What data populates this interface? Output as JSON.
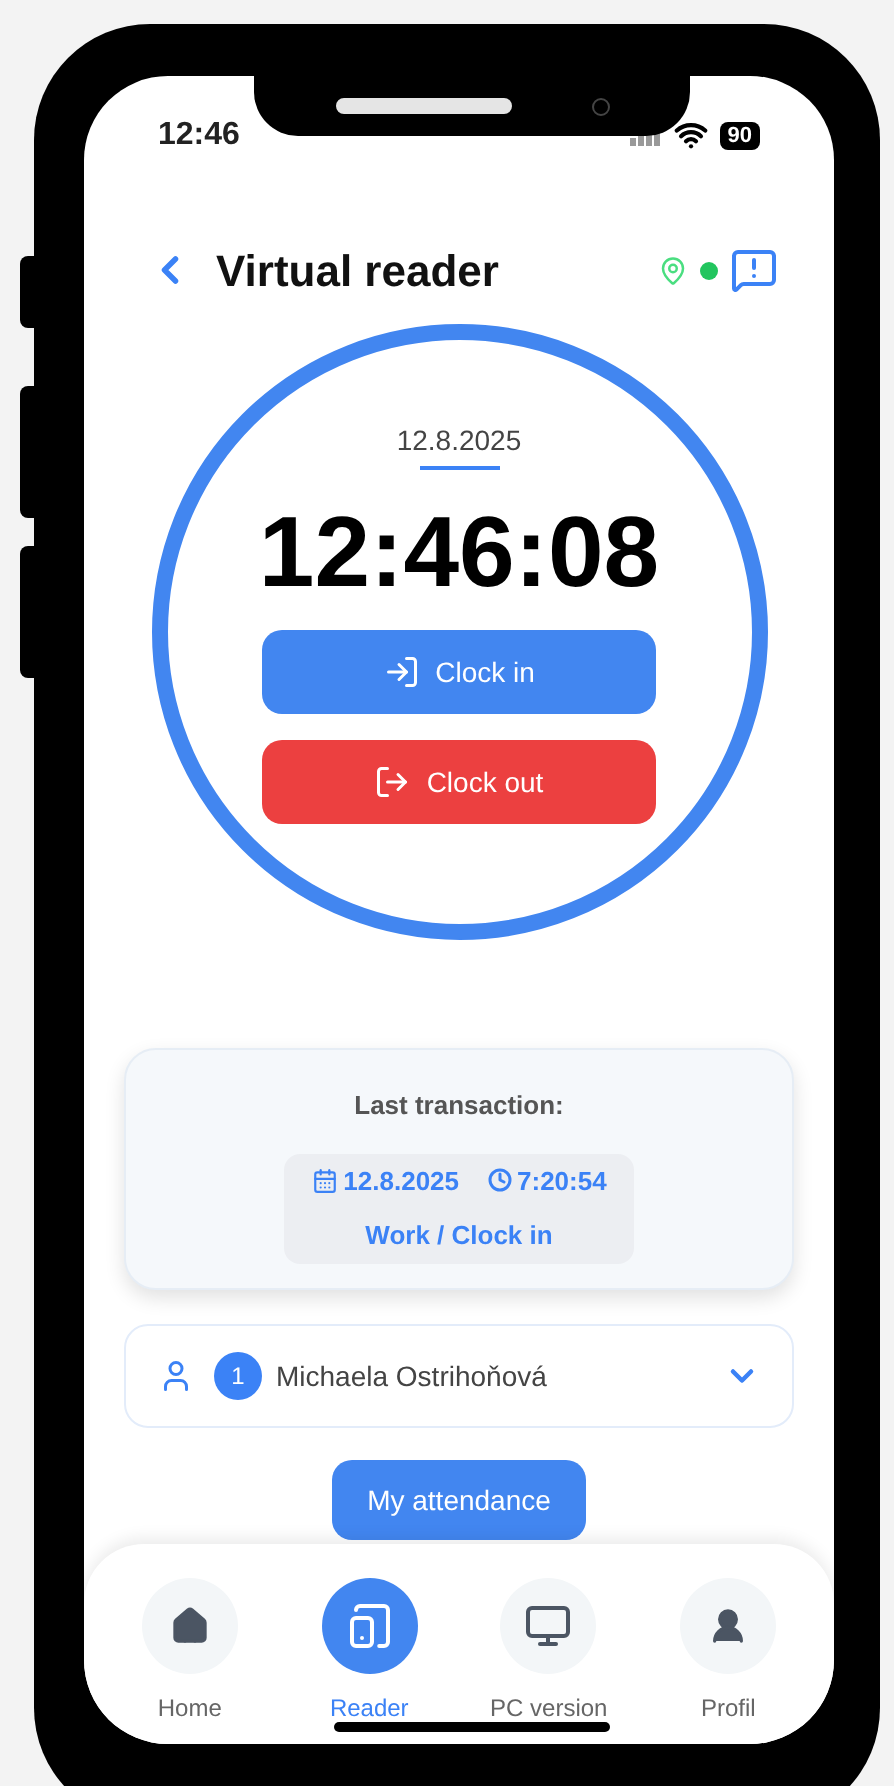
{
  "status_bar": {
    "time": "12:46",
    "battery": "90"
  },
  "header": {
    "title": "Virtual reader",
    "online": true
  },
  "clock": {
    "date": "12.8.2025",
    "time": "12:46:08",
    "buttons": [
      {
        "label": "Clock in",
        "kind": "in"
      },
      {
        "label": "Clock out",
        "kind": "out"
      }
    ]
  },
  "last_transaction": {
    "title": "Last transaction:",
    "date": "12.8.2025",
    "time": "7:20:54",
    "type": "Work / Clock in"
  },
  "user": {
    "badge": "1",
    "name": "Michaela Ostrihoňová",
    "expanded": false
  },
  "attendance_button": "My attendance",
  "nav": [
    {
      "label": "Home",
      "kind": "home",
      "selected": false
    },
    {
      "label": "Reader",
      "kind": "reader",
      "selected": true
    },
    {
      "label": "PC version",
      "kind": "pc",
      "selected": false
    },
    {
      "label": "Profil",
      "kind": "profile",
      "selected": false
    }
  ]
}
